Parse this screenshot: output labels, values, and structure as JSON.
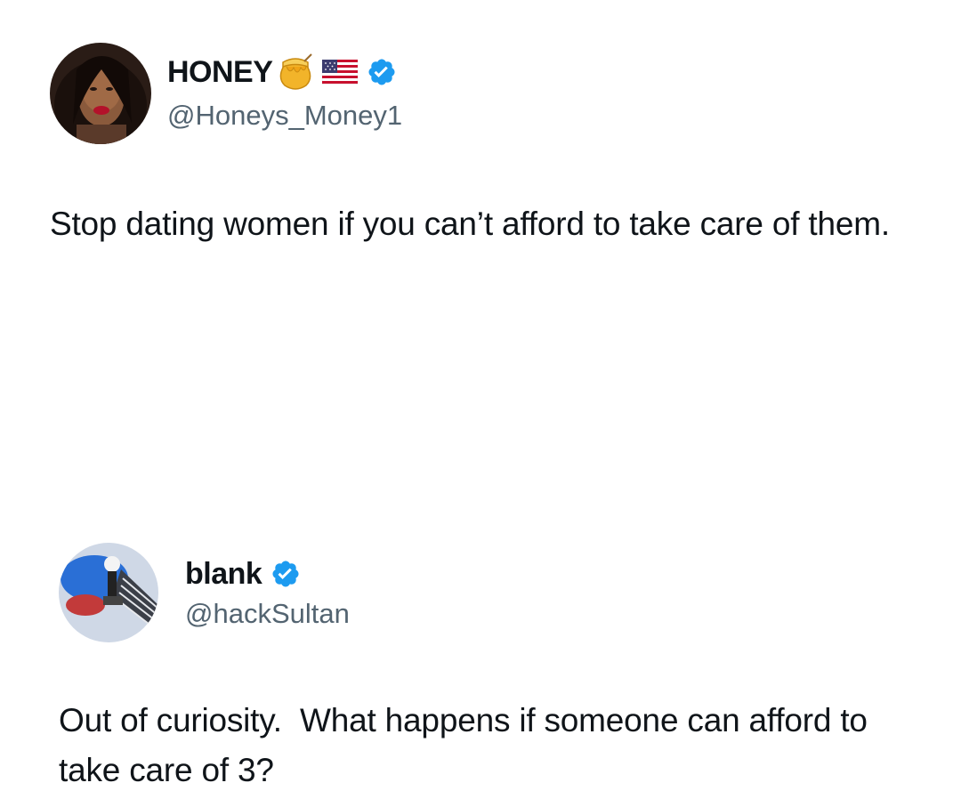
{
  "tweets": [
    {
      "display_name": "HONEY",
      "handle": "@Honeys_Money1",
      "text": "Stop dating women if you can’t afford to take care of them.",
      "name_icons": [
        "honey-pot-emoji",
        "us-flag-emoji",
        "verified-badge"
      ]
    },
    {
      "display_name": "blank",
      "handle": "@hackSultan",
      "text": "Out of curiosity.  What happens if someone can afford to take care of 3?",
      "name_icons": [
        "verified-badge"
      ]
    }
  ],
  "colors": {
    "text_primary": "#0f1419",
    "text_secondary": "#536471",
    "verified_blue": "#1d9bf0",
    "background": "#ffffff"
  }
}
